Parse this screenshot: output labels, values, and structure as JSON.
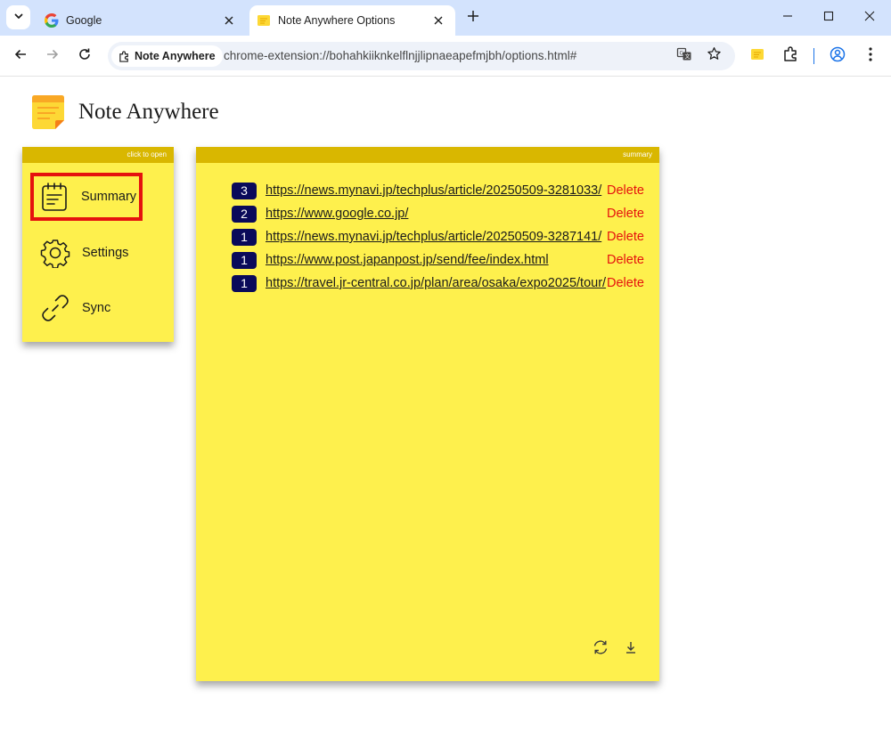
{
  "browser": {
    "tabs": [
      {
        "title": "Google",
        "active": false
      },
      {
        "title": "Note Anywhere Options",
        "active": true
      }
    ],
    "site_chip": "Note Anywhere",
    "url": "chrome-extension://bohahkiiknkelflnjjlipnaeapefmjbh/options.html#"
  },
  "app": {
    "title": "Note Anywhere"
  },
  "menu": {
    "strip_label": "click to open",
    "items": [
      {
        "label": "Summary",
        "icon": "notepad-icon",
        "selected": true
      },
      {
        "label": "Settings",
        "icon": "gear-icon",
        "selected": false
      },
      {
        "label": "Sync",
        "icon": "link-icon",
        "selected": false
      }
    ]
  },
  "summary": {
    "strip_label": "summary",
    "delete_label": "Delete",
    "rows": [
      {
        "count": "3",
        "url": "https://news.mynavi.jp/techplus/article/20250509-3281033/"
      },
      {
        "count": "2",
        "url": "https://www.google.co.jp/"
      },
      {
        "count": "1",
        "url": "https://news.mynavi.jp/techplus/article/20250509-3287141/"
      },
      {
        "count": "1",
        "url": "https://www.post.japanpost.jp/send/fee/index.html"
      },
      {
        "count": "1",
        "url": "https://travel.jr-central.co.jp/plan/area/osaka/expo2025/tour/"
      }
    ]
  },
  "colors": {
    "panel": "#fef04d",
    "strip": "#d9b700",
    "badge": "#0a0a5a",
    "delete": "#e5120e",
    "highlight": "#e5120e"
  }
}
